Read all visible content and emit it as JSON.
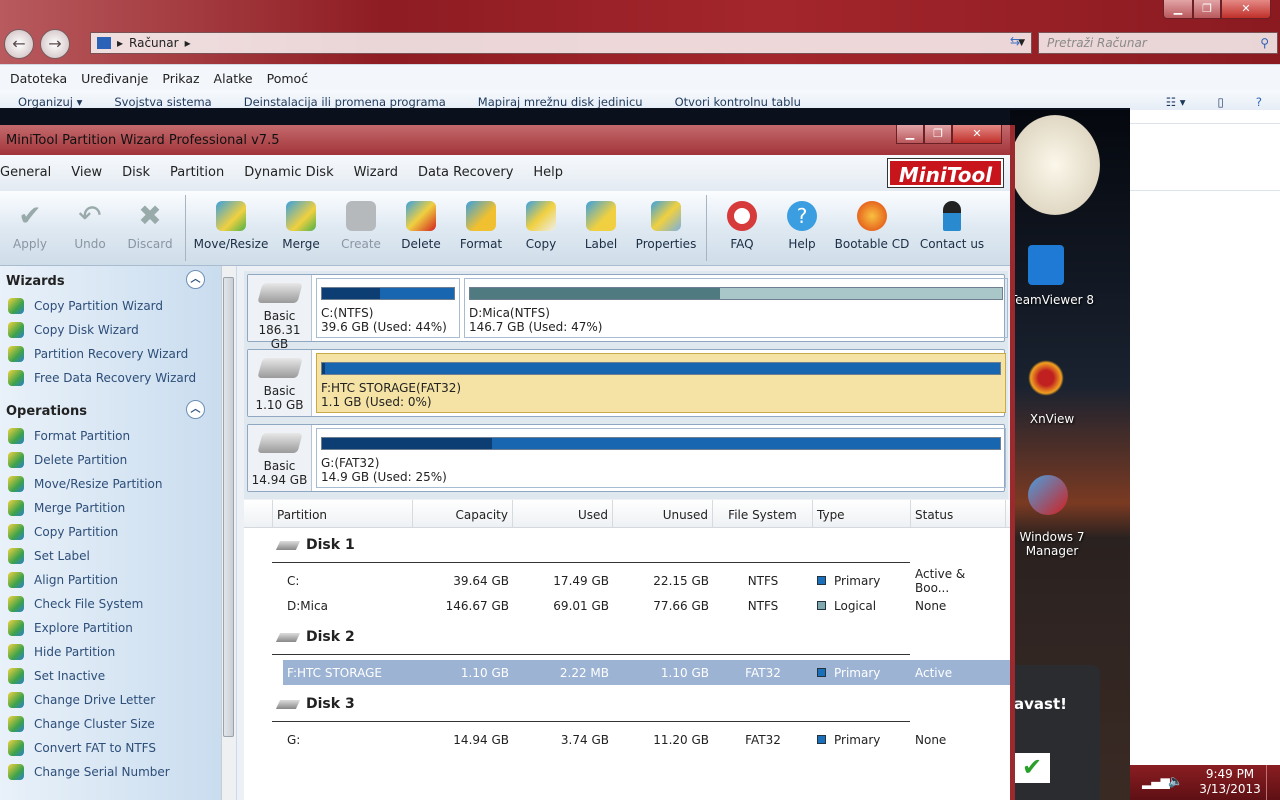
{
  "explorer": {
    "breadcrumb": "Računar",
    "search_placeholder": "Pretraži Računar",
    "menu": [
      "Datoteka",
      "Uređivanje",
      "Prikaz",
      "Alatke",
      "Pomoć"
    ],
    "commands": [
      "Organizuj ▾",
      "Svojstva sistema",
      "Deinstalacija ili promena programa",
      "Mapiraj mrežnu disk jedinicu",
      "Otvori kontrolnu tablu"
    ]
  },
  "desktop": {
    "icons": [
      {
        "label": "TeamViewer 8"
      },
      {
        "label": "XnView"
      },
      {
        "label": "Windows 7 Manager"
      }
    ],
    "avast": "avast!"
  },
  "taskbar": {
    "time": "9:49 PM",
    "date": "3/13/2013"
  },
  "app": {
    "title": "MiniTool Partition Wizard Professional v7.5",
    "logo": "MiniTool",
    "menu": [
      "General",
      "View",
      "Disk",
      "Partition",
      "Dynamic Disk",
      "Wizard",
      "Data Recovery",
      "Help"
    ],
    "toolbar": [
      {
        "label": "Apply",
        "disabled": true
      },
      {
        "label": "Undo",
        "disabled": true
      },
      {
        "label": "Discard",
        "disabled": true
      },
      {
        "label": "Move/Resize"
      },
      {
        "label": "Merge"
      },
      {
        "label": "Create",
        "disabled": true
      },
      {
        "label": "Delete"
      },
      {
        "label": "Format"
      },
      {
        "label": "Copy"
      },
      {
        "label": "Label"
      },
      {
        "label": "Properties"
      },
      {
        "label": "FAQ"
      },
      {
        "label": "Help"
      },
      {
        "label": "Bootable CD"
      },
      {
        "label": "Contact us"
      }
    ],
    "wizards": {
      "title": "Wizards",
      "items": [
        "Copy Partition Wizard",
        "Copy Disk Wizard",
        "Partition Recovery Wizard",
        "Free Data Recovery Wizard"
      ]
    },
    "operations": {
      "title": "Operations",
      "items": [
        "Format Partition",
        "Delete Partition",
        "Move/Resize Partition",
        "Merge Partition",
        "Copy Partition",
        "Set Label",
        "Align Partition",
        "Check File System",
        "Explore Partition",
        "Hide Partition",
        "Set Inactive",
        "Change Drive Letter",
        "Change Cluster Size",
        "Convert FAT to NTFS",
        "Change Serial Number"
      ]
    },
    "disk_map": [
      {
        "type": "Basic",
        "size": "186.31 GB",
        "partitions": [
          {
            "name": "C:(NTFS)",
            "info": "39.6 GB (Used: 44%)",
            "used": 44,
            "color": "#1a6fb8"
          },
          {
            "name": "D:Mica(NTFS)",
            "info": "146.7 GB (Used: 47%)",
            "used": 47,
            "color": "#5f8a90"
          }
        ]
      },
      {
        "type": "Basic",
        "size": "1.10 GB",
        "partitions": [
          {
            "name": "F:HTC STORAGE(FAT32)",
            "info": "1.1 GB (Used: 0%)",
            "used": 0,
            "color": "#1a6fb8"
          }
        ]
      },
      {
        "type": "Basic",
        "size": "14.94 GB",
        "partitions": [
          {
            "name": "G:(FAT32)",
            "info": "14.9 GB (Used: 25%)",
            "used": 25,
            "color": "#1a6fb8"
          }
        ]
      }
    ],
    "table": {
      "headers": [
        "Partition",
        "Capacity",
        "Used",
        "Unused",
        "File System",
        "Type",
        "Status"
      ],
      "disks": [
        {
          "name": "Disk 1",
          "rows": [
            [
              "C:",
              "39.64 GB",
              "17.49 GB",
              "22.15 GB",
              "NTFS",
              "Primary",
              "Active & Boo..."
            ],
            [
              "D:Mica",
              "146.67 GB",
              "69.01 GB",
              "77.66 GB",
              "NTFS",
              "Logical",
              "None"
            ]
          ]
        },
        {
          "name": "Disk 2",
          "rows": [
            [
              "F:HTC STORAGE",
              "1.10 GB",
              "2.22 MB",
              "1.10 GB",
              "FAT32",
              "Primary",
              "Active"
            ]
          ]
        },
        {
          "name": "Disk 3",
          "rows": [
            [
              "G:",
              "14.94 GB",
              "3.74 GB",
              "11.20 GB",
              "FAT32",
              "Primary",
              "None"
            ]
          ]
        }
      ]
    }
  }
}
